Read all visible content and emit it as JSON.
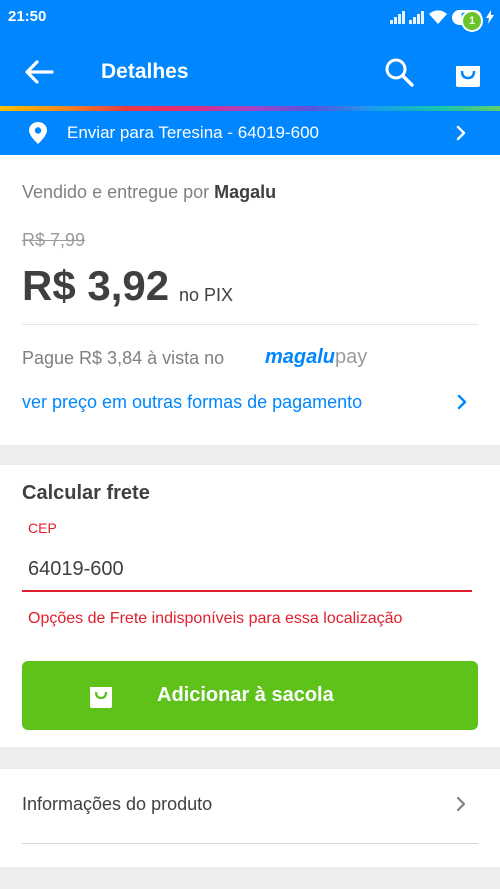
{
  "status_bar": {
    "time": "21:50",
    "battery": "83"
  },
  "app_bar": {
    "title": "Detalhes",
    "cart_count": "1"
  },
  "shipping_bar": {
    "label": "Enviar para Teresina - 64019-600"
  },
  "product": {
    "sold_by_prefix": "Vendido e entregue por ",
    "sold_by_name": "Magalu",
    "old_price": "R$ 7,99",
    "price": "R$ 3,92",
    "price_suffix": "no PIX",
    "pague_text": "Pague R$ 3,84 à vista no",
    "magalupay_brand": "magalu",
    "magalupay_suffix": "pay",
    "other_payments_link": "ver preço em outras formas de pagamento"
  },
  "freight": {
    "title": "Calcular frete",
    "cep_label": "CEP",
    "cep_value": "64019-600",
    "error": "Opções de Frete indisponíveis para essa localização",
    "add_button": "Adicionar à sacola"
  },
  "info": {
    "label": "Informações do produto"
  },
  "colors": {
    "brand_blue": "#0086ff",
    "green": "#5fc21b",
    "error_red": "#e0202c"
  }
}
